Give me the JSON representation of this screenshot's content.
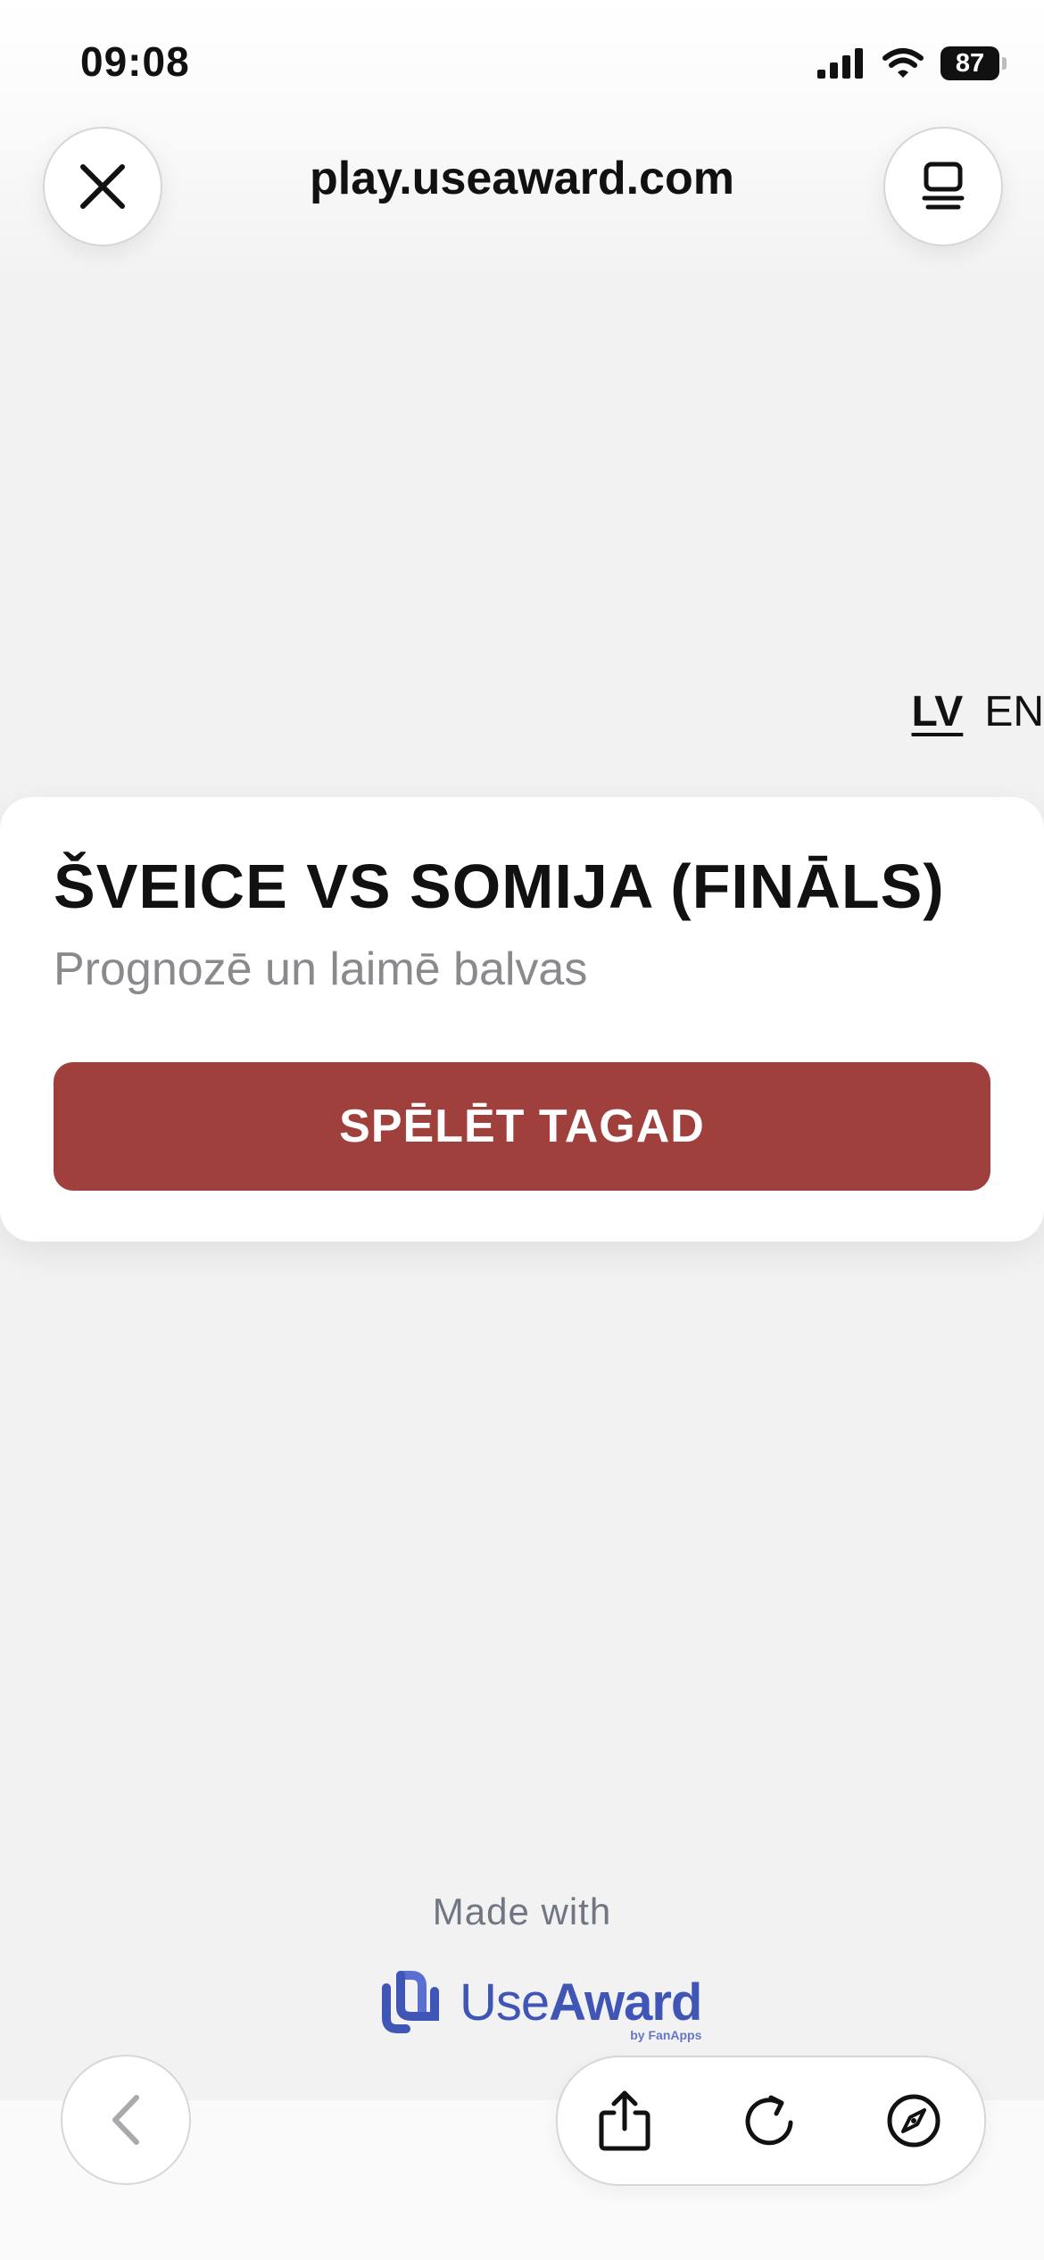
{
  "status_bar": {
    "time": "09:08",
    "battery": "87"
  },
  "browser": {
    "url": "play.useaward.com"
  },
  "language": {
    "options": [
      "LV",
      "EN"
    ],
    "selected": "LV"
  },
  "card": {
    "title": "ŠVEICE VS SOMIJA (FINĀLS)",
    "subtitle": "Prognozē un laimē balvas",
    "button_label": "SPĒLĒT TAGAD"
  },
  "footer": {
    "made_with": "Made with",
    "brand_use": "Use",
    "brand_award": "Award",
    "brand_by": "by FanApps"
  },
  "colors": {
    "primary_button": "#a0403d",
    "brand_blue": "#3f56b7",
    "muted_text": "#8a8a8e"
  },
  "icons": {
    "close": "close-icon",
    "tabs": "tabs-icon",
    "back": "chevron-left-icon",
    "share": "share-icon",
    "reload": "reload-icon",
    "compass": "compass-icon"
  }
}
